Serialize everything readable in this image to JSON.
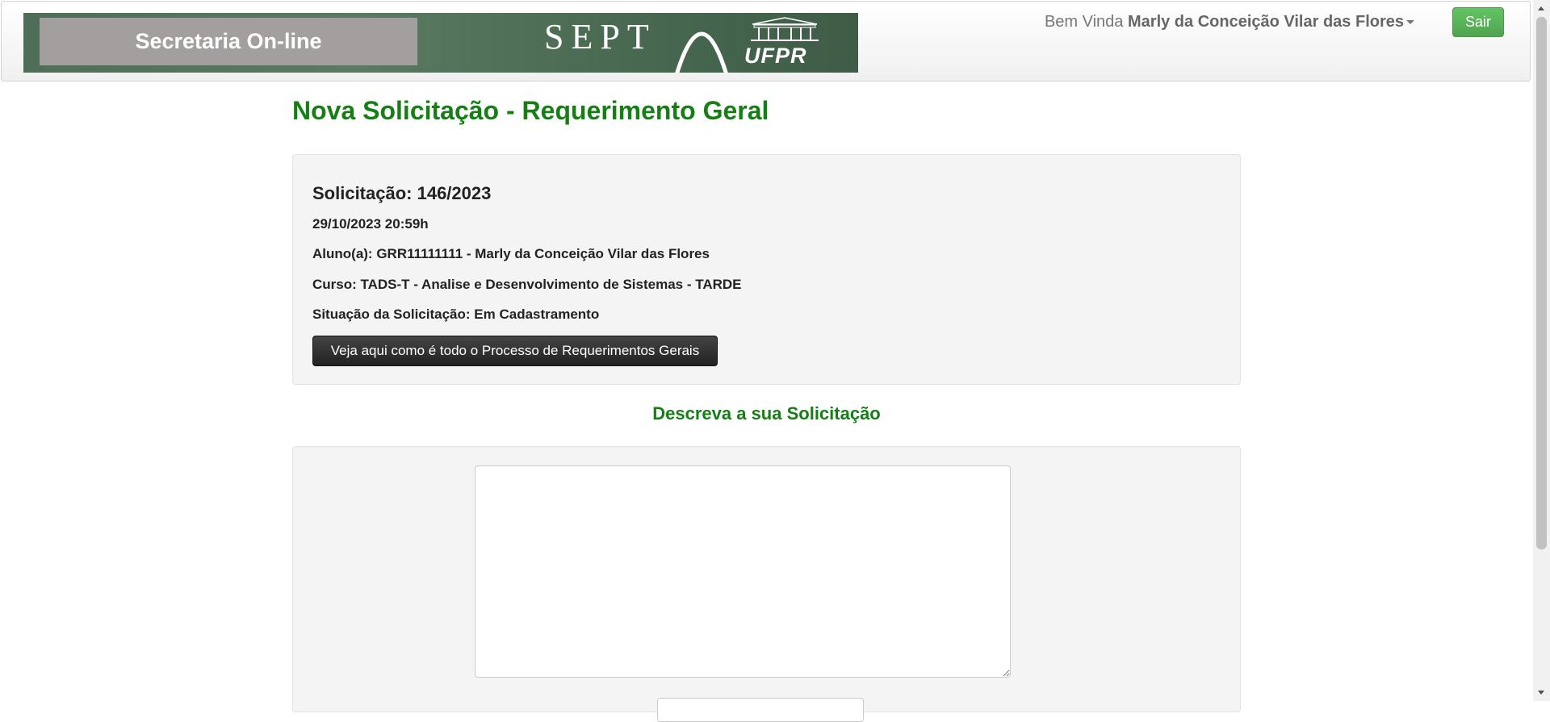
{
  "header": {
    "banner_title": "Secretaria On-line",
    "sept_logo": "SEPT",
    "ufpr_logo": "UFPR",
    "greeting": "Bem Vinda",
    "user_name": "Marly da Conceição Vilar das Flores",
    "logout_label": "Sair"
  },
  "page": {
    "title": "Nova Solicitação - Requerimento Geral"
  },
  "request": {
    "number": "Solicitação: 146/2023",
    "datetime": "29/10/2023 20:59h",
    "student": "Aluno(a): GRR11111111 - Marly da Conceição Vilar das Flores",
    "course": "Curso: TADS-T - Analise e Desenvolvimento de Sistemas - TARDE",
    "status": "Situação da Solicitação: Em Cadastramento",
    "process_button": "Veja aqui como é todo o Processo de Requerimentos Gerais"
  },
  "form": {
    "section_title": "Descreva a sua Solicitação",
    "description_value": ""
  },
  "colors": {
    "accent_green": "#157f15",
    "logout_green": "#51a351",
    "dark_button": "#222222",
    "well_background": "#f4f4f4"
  },
  "icons": {
    "user_menu_caret": "caret-down-icon",
    "scroll_up": "scroll-up-arrow-icon",
    "scroll_down": "scroll-down-arrow-icon"
  }
}
